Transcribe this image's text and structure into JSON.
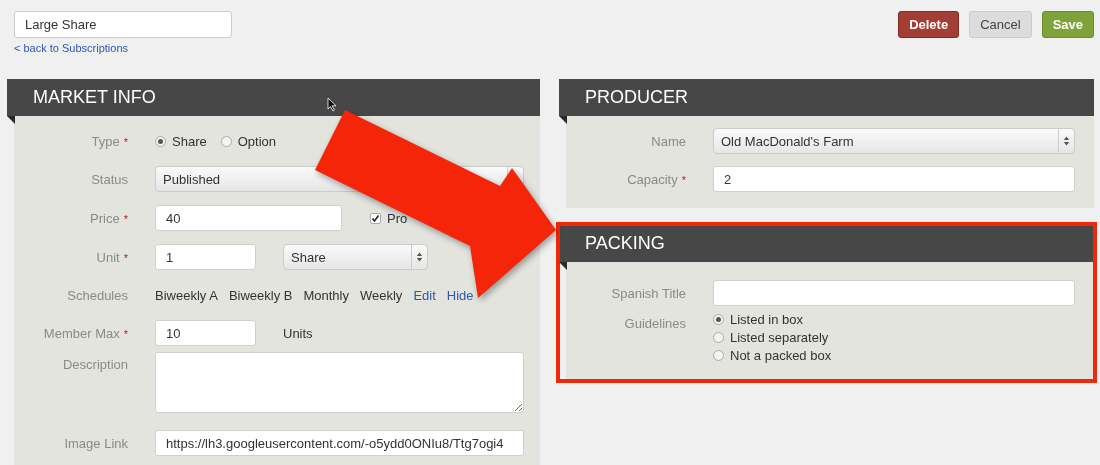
{
  "title_field": {
    "value": "Large Share"
  },
  "back_link": "< back to Subscriptions",
  "buttons": [
    {
      "label": "Delete",
      "kind": "danger"
    },
    {
      "label": "Cancel",
      "kind": "plain"
    },
    {
      "label": "Save",
      "kind": "primary"
    }
  ],
  "market_info": {
    "title": "MARKET INFO",
    "fields": [
      {
        "kind": "radio",
        "label": "Type",
        "mark": "*",
        "options": [
          {
            "label": "Share",
            "selected": true
          },
          {
            "label": "Option",
            "selected": false
          }
        ]
      },
      {
        "kind": "select",
        "label": "Status",
        "value": "Published"
      },
      {
        "kind": "text_checkbox",
        "label": "Price",
        "mark": "*",
        "value": "40",
        "checkbox": {
          "label": "Pro",
          "checked": true
        }
      },
      {
        "kind": "text_select",
        "label": "Unit",
        "mark": "*",
        "value": "1",
        "select": "Share"
      },
      {
        "kind": "schedules",
        "label": "Schedules",
        "items": [
          "Biweekly A",
          "Biweekly B",
          "Monthly",
          "Weekly"
        ],
        "links": [
          "Edit",
          "Hide"
        ]
      },
      {
        "kind": "text_unit",
        "label": "Member Max",
        "mark": "*",
        "value": "10",
        "unit": "Units"
      },
      {
        "kind": "textarea",
        "label": "Description"
      },
      {
        "kind": "text",
        "label": "Image Link",
        "value": "https://lh3.googleusercontent.com/-o5ydd0ONIu8/Ttg7ogi4"
      }
    ]
  },
  "producer": {
    "title": "PRODUCER",
    "fields": [
      {
        "kind": "select",
        "label": "Name",
        "value": "Old MacDonald's Farm"
      },
      {
        "kind": "text",
        "label": "Capacity",
        "mark": "*",
        "value": "2"
      }
    ]
  },
  "packing": {
    "title": "PACKING",
    "highlighted": true,
    "fields": [
      {
        "kind": "text",
        "label": "Spanish Title"
      },
      {
        "kind": "radio_stack",
        "label": "Guidelines",
        "options": [
          {
            "label": "Listed in box",
            "selected": true
          },
          {
            "label": "Listed separately",
            "selected": false
          },
          {
            "label": "Not a packed box",
            "selected": false
          }
        ]
      }
    ]
  }
}
